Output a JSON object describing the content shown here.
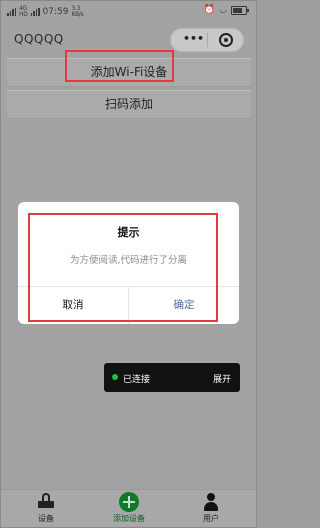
{
  "status_bar": {
    "network_type_top": "4G",
    "network_type_bottom": "HD",
    "time": "07:59",
    "speed_top": "3.3",
    "speed_bottom": "KB/s",
    "battery_level": 0.75
  },
  "navbar": {
    "title": "QQQQQ",
    "more_label": "•••"
  },
  "menu": {
    "add_wifi_device": "添加Wi-Fi设备",
    "scan_to_add": "扫码添加"
  },
  "dialog": {
    "title": "提示",
    "message": "为方便阅读,代码进行了分离",
    "cancel_label": "取消",
    "confirm_label": "确定"
  },
  "toast": {
    "status": "已连接",
    "expand_label": "展开",
    "status_color": "#19c34a"
  },
  "tabbar": {
    "tabs": [
      {
        "label": "设备",
        "icon": "router-icon"
      },
      {
        "label": "添加设备",
        "icon": "add-circle-icon"
      },
      {
        "label": "用户",
        "icon": "user-icon"
      }
    ]
  },
  "colors": {
    "highlight": "#e23c3c",
    "confirm": "#4e6ea4",
    "accent_green": "#0e7a2a"
  }
}
